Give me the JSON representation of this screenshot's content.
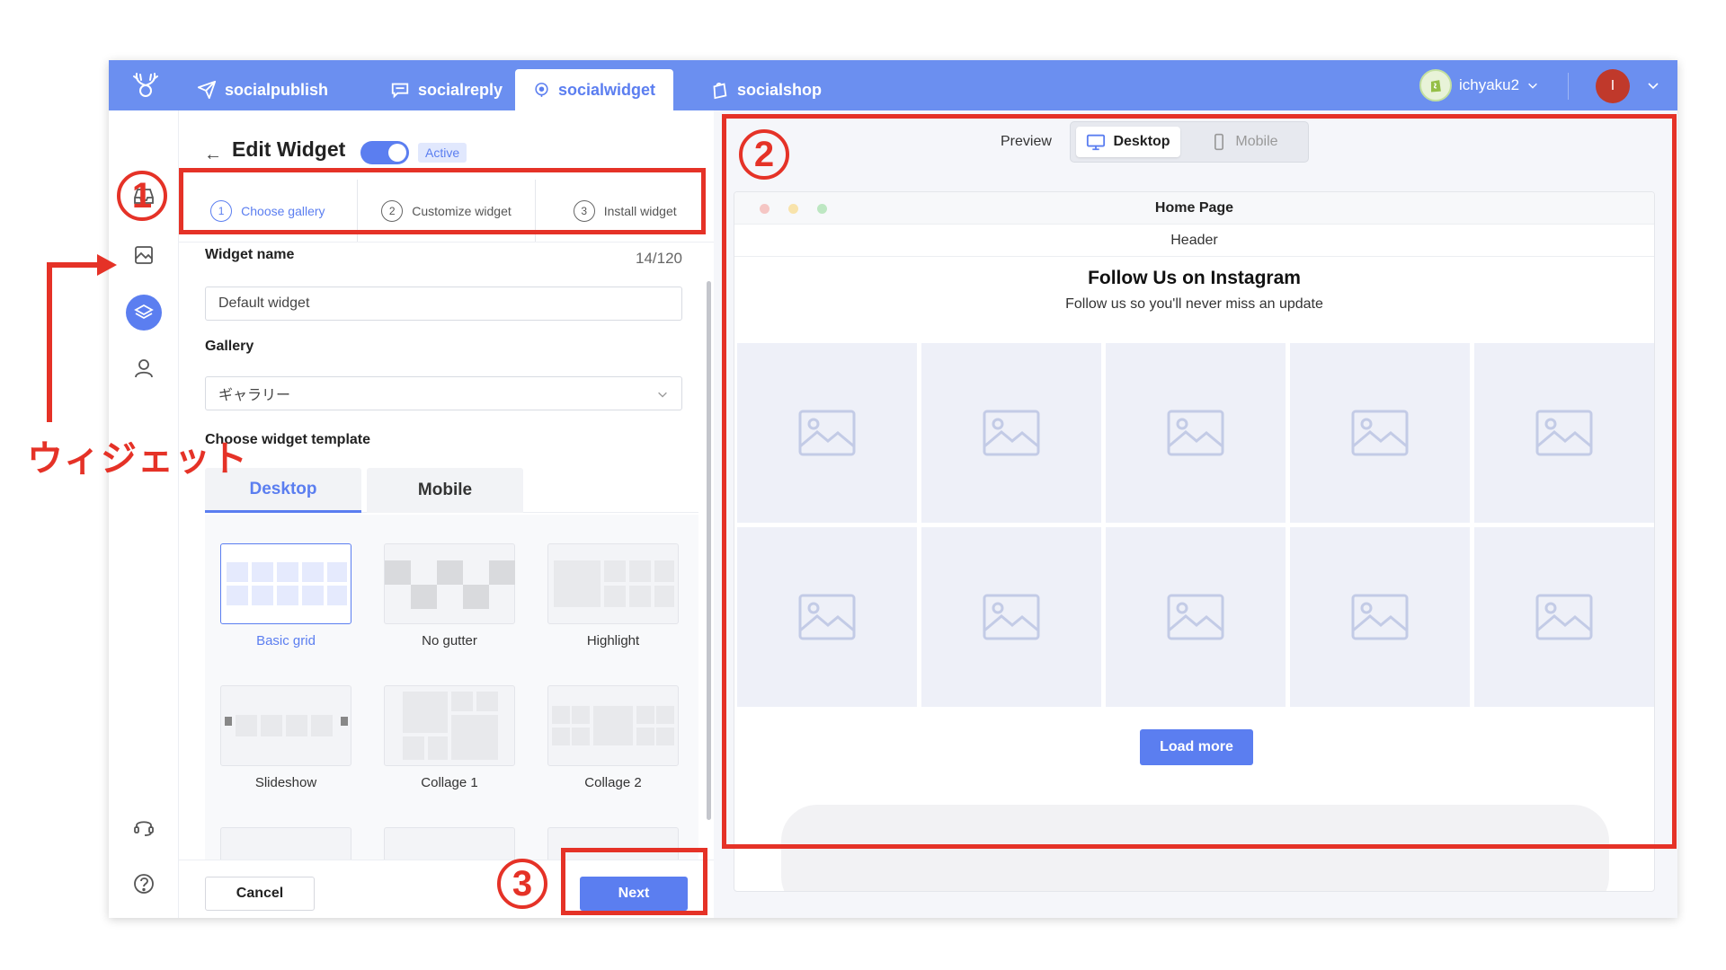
{
  "nav": {
    "tabs": [
      {
        "label": "socialpublish",
        "icon": "paper-plane-icon"
      },
      {
        "label": "socialreply",
        "icon": "chat-reply-icon"
      },
      {
        "label": "socialwidget",
        "icon": "widget-pin-icon",
        "active": true
      },
      {
        "label": "socialshop",
        "icon": "shopping-bag-icon"
      }
    ],
    "store_name": "ichyaku2",
    "user_initial": "I"
  },
  "editor": {
    "title": "Edit Widget",
    "status_badge": "Active",
    "toggle_on": true,
    "steps": [
      {
        "num": "1",
        "label": "Choose gallery",
        "active": true
      },
      {
        "num": "2",
        "label": "Customize widget"
      },
      {
        "num": "3",
        "label": "Install widget"
      }
    ],
    "widget_name_label": "Widget name",
    "widget_name_count": "14/120",
    "widget_name_value": "Default widget",
    "gallery_label": "Gallery",
    "gallery_value": "ギャラリー",
    "template_label": "Choose widget template",
    "template_tabs": [
      "Desktop",
      "Mobile"
    ],
    "templates": [
      "Basic grid",
      "No gutter",
      "Highlight",
      "Slideshow",
      "Collage 1",
      "Collage 2"
    ],
    "selected_template": "Basic grid",
    "cancel_label": "Cancel",
    "next_label": "Next"
  },
  "preview": {
    "label": "Preview",
    "device_desktop": "Desktop",
    "device_mobile": "Mobile",
    "page_title": "Home Page",
    "site_header": "Header",
    "widget_title": "Follow Us on Instagram",
    "widget_subtitle": "Follow us so you'll never miss an update",
    "load_more": "Load more"
  },
  "annotations": {
    "num1": "1",
    "num2": "2",
    "num3": "3",
    "widget_note": "ウィジェット"
  },
  "colors": {
    "accent": "#5b7ef0",
    "nav_bg": "#6b8ff0",
    "annotation_red": "#e53227"
  }
}
